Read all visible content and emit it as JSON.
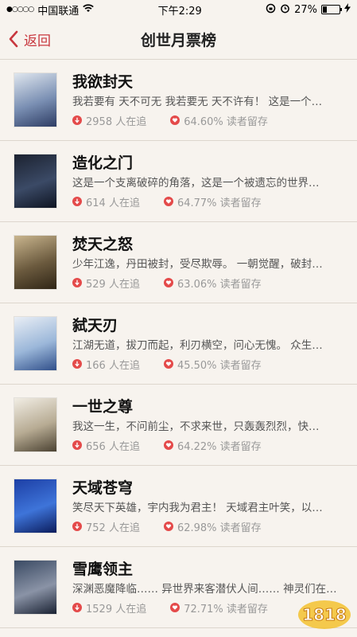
{
  "status": {
    "carrier": "中国联通",
    "time": "下午2:29",
    "battery": "27%"
  },
  "nav": {
    "back_label": "返回",
    "title": "创世月票榜"
  },
  "books": [
    {
      "title": "我欲封天",
      "desc": "我若要有 天不可无 我若要无 天不许有！ 这是一个…",
      "followers": "2958 人在追",
      "retention": "64.60% 读者留存",
      "cover_colors": [
        "#dfe6ee",
        "#7a8fb3",
        "#2d3c63"
      ]
    },
    {
      "title": "造化之门",
      "desc": "这是一个支离破碎的角落，这是一个被遗忘的世界…",
      "followers": "614 人在追",
      "retention": "64.77% 读者留存",
      "cover_colors": [
        "#1c2230",
        "#3b4a66",
        "#0e1422"
      ]
    },
    {
      "title": "焚天之怒",
      "desc": "少年江逸，丹田被封，受尽欺辱。 一朝觉醒，破封…",
      "followers": "529 人在追",
      "retention": "63.06% 读者留存",
      "cover_colors": [
        "#c9b58e",
        "#6b5a3e",
        "#2f2516"
      ]
    },
    {
      "title": "弑天刃",
      "desc": "江湖无道，拔刀而起，利刃横空，问心无愧。 众生…",
      "followers": "166 人在追",
      "retention": "45.50% 读者留存",
      "cover_colors": [
        "#e9eef5",
        "#9bb7d9",
        "#304f8a"
      ]
    },
    {
      "title": "一世之尊",
      "desc": "我这一生，不问前尘，不求来世，只轰轰烈烈，快…",
      "followers": "656 人在追",
      "retention": "64.22% 读者留存",
      "cover_colors": [
        "#f1ede4",
        "#b7ab93",
        "#4b4232"
      ]
    },
    {
      "title": "天域苍穹",
      "desc": "笑尽天下英雄，宇内我为君主！ 天域君主叶笑，以…",
      "followers": "752 人在追",
      "retention": "62.98% 读者留存",
      "cover_colors": [
        "#1d3fa5",
        "#3e74d9",
        "#0b1c5c"
      ]
    },
    {
      "title": "雪鹰领主",
      "desc": "深渊恶魔降临…… 异世界来客潜伏人间…… 神灵们在…",
      "followers": "1529 人在追",
      "retention": "72.71% 读者留存",
      "cover_colors": [
        "#3a4a63",
        "#8a93a6",
        "#1a2233"
      ]
    }
  ]
}
